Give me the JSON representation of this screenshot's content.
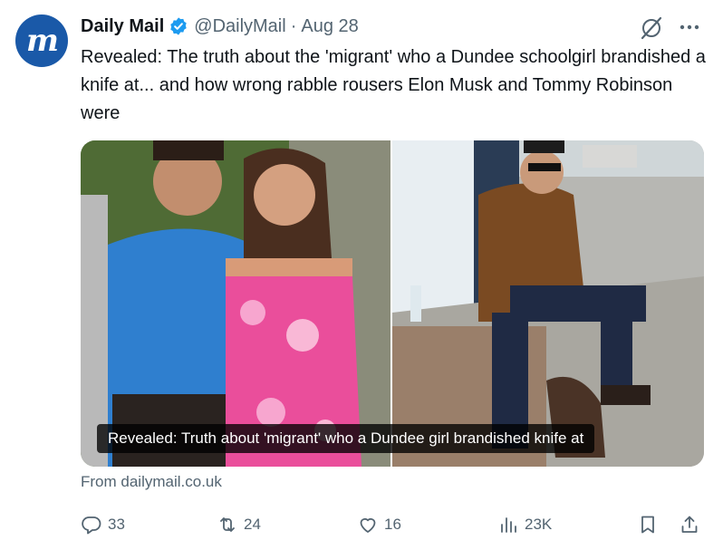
{
  "account": {
    "avatar_letter": "m",
    "name": "Daily Mail",
    "handle": "@DailyMail",
    "separator": "·",
    "date": "Aug 28",
    "verified": true,
    "avatar_color": "#1a59a8",
    "verified_color": "#1d9bf0"
  },
  "tweet": {
    "text": "Revealed: The truth about the 'migrant' who a Dundee schoolgirl brandished a knife at... and how wrong rabble rousers Elon Musk and Tommy Robinson were"
  },
  "card": {
    "caption": "Revealed: Truth about 'migrant' who a Dundee girl brandished knife at",
    "source": "From dailymail.co.uk"
  },
  "actions": {
    "replies": "33",
    "reposts": "24",
    "likes": "16",
    "views": "23K"
  },
  "colors": {
    "text": "#0f1419",
    "secondary": "#536471"
  }
}
